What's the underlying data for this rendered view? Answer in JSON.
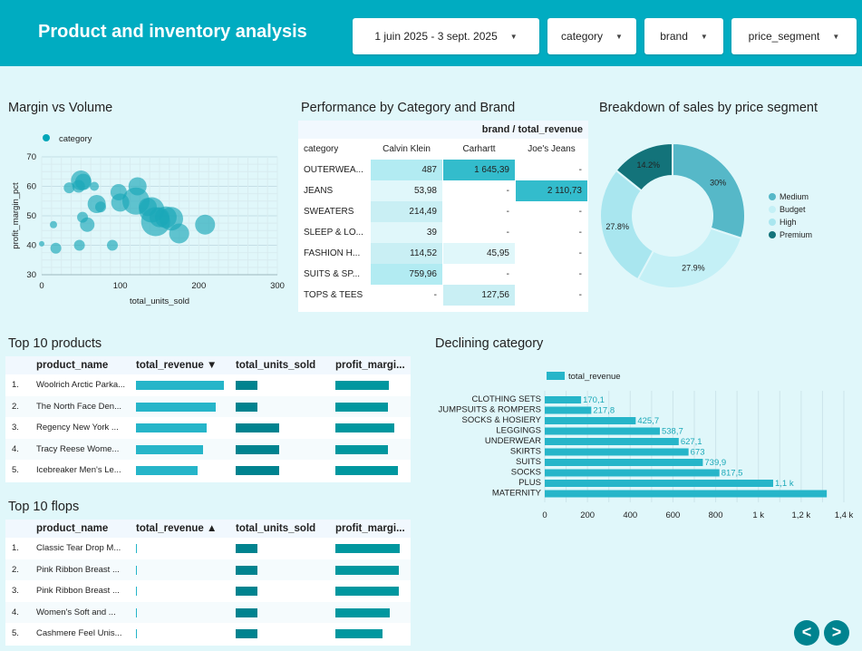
{
  "header": {
    "title": "Product and inventory analysis",
    "filters": {
      "date": "1 juin 2025 - 3 sept. 2025",
      "category": "category",
      "brand": "brand",
      "price_segment": "price_segment"
    }
  },
  "colors": {
    "header": "#00acc1",
    "background": "#e0f7fa",
    "bar": "#26b5c9",
    "dark": "#00838f",
    "pivot_high": "#4fc3d1",
    "pivot_mid": "#b2ebf2",
    "pivot_low": "#e0f7fa"
  },
  "scatter": {
    "title": "Margin vs Volume",
    "legend": "category",
    "xlabel": "total_units_sold",
    "ylabel": "profit_margin_pct",
    "xticks": [
      "0",
      "100",
      "200",
      "300"
    ],
    "yticks": [
      "30",
      "40",
      "50",
      "60",
      "70"
    ]
  },
  "pivot": {
    "title": "Performance by Category and Brand",
    "header": "brand / total_revenue",
    "row_header": "category",
    "columns": [
      "Calvin Klein",
      "Carhartt",
      "Joe's Jeans"
    ],
    "rows": [
      {
        "label": "OUTERWEA...",
        "values": [
          "487",
          "1 645,39",
          "-"
        ]
      },
      {
        "label": "JEANS",
        "values": [
          "53,98",
          "-",
          "2 110,73"
        ]
      },
      {
        "label": "SWEATERS",
        "values": [
          "214,49",
          "-",
          "-"
        ]
      },
      {
        "label": "SLEEP & LO...",
        "values": [
          "39",
          "-",
          "-"
        ]
      },
      {
        "label": "FASHION H...",
        "values": [
          "114,52",
          "45,95",
          "-"
        ]
      },
      {
        "label": "SUITS & SP...",
        "values": [
          "759,96",
          "-",
          "-"
        ]
      },
      {
        "label": "TOPS & TEES",
        "values": [
          "-",
          "127,56",
          "-"
        ]
      }
    ]
  },
  "donut": {
    "title": "Breakdown of sales by price segment",
    "legend": [
      "Medium",
      "Budget",
      "High",
      "Premium"
    ]
  },
  "top_products": {
    "title": "Top 10 products",
    "columns": [
      "product_name",
      "total_revenue",
      "total_units_sold",
      "profit_margi..."
    ],
    "sort_indicator": "▼",
    "rows": [
      {
        "num": "1.",
        "name": "Woolrich Arctic Parka...",
        "revenue": 1.0,
        "units": 0.25,
        "margin": 0.83
      },
      {
        "num": "2.",
        "name": "The North Face Den...",
        "revenue": 0.91,
        "units": 0.25,
        "margin": 0.82
      },
      {
        "num": "3.",
        "name": "Regency New York ...",
        "revenue": 0.8,
        "units": 0.5,
        "margin": 0.92
      },
      {
        "num": "4.",
        "name": "Tracy Reese Wome...",
        "revenue": 0.76,
        "units": 0.5,
        "margin": 0.81
      },
      {
        "num": "5.",
        "name": "Icebreaker Men's Le...",
        "revenue": 0.7,
        "units": 0.5,
        "margin": 0.97
      }
    ]
  },
  "top_flops": {
    "title": "Top 10 flops",
    "columns": [
      "product_name",
      "total_revenue",
      "total_units_sold",
      "profit_margi..."
    ],
    "sort_indicator": "▲",
    "rows": [
      {
        "num": "1.",
        "name": "Classic Tear Drop M...",
        "revenue": 0.01,
        "units": 0.25,
        "margin": 1.0
      },
      {
        "num": "2.",
        "name": "Pink Ribbon Breast ...",
        "revenue": 0.01,
        "units": 0.25,
        "margin": 0.98
      },
      {
        "num": "3.",
        "name": "Pink Ribbon Breast ...",
        "revenue": 0.01,
        "units": 0.25,
        "margin": 0.98
      },
      {
        "num": "4.",
        "name": "Women's Soft and ...",
        "revenue": 0.01,
        "units": 0.25,
        "margin": 0.84
      },
      {
        "num": "5.",
        "name": "Cashmere Feel Unis...",
        "revenue": 0.01,
        "units": 0.25,
        "margin": 0.73
      }
    ]
  },
  "bar_chart": {
    "title": "Declining category",
    "legend": "total_revenue",
    "xticks": [
      "0",
      "200",
      "400",
      "600",
      "800",
      "1 k",
      "1,2 k",
      "1,4 k"
    ]
  },
  "chart_data": [
    {
      "type": "scatter",
      "xlabel": "total_units_sold",
      "ylabel": "profit_margin_pct",
      "xlim": [
        0,
        300
      ],
      "ylim": [
        30,
        70
      ],
      "legend": [
        "category"
      ],
      "points": [
        {
          "x": 0,
          "y": 40.5,
          "s": 3
        },
        {
          "x": 15,
          "y": 47,
          "s": 4
        },
        {
          "x": 18,
          "y": 39,
          "s": 6
        },
        {
          "x": 35,
          "y": 59.5,
          "s": 6
        },
        {
          "x": 47,
          "y": 60,
          "s": 7
        },
        {
          "x": 50,
          "y": 62,
          "s": 11
        },
        {
          "x": 53,
          "y": 61.5,
          "s": 9
        },
        {
          "x": 48,
          "y": 40,
          "s": 6
        },
        {
          "x": 52,
          "y": 49.5,
          "s": 6
        },
        {
          "x": 58,
          "y": 47,
          "s": 8
        },
        {
          "x": 67,
          "y": 60,
          "s": 5
        },
        {
          "x": 70,
          "y": 54,
          "s": 10
        },
        {
          "x": 75,
          "y": 53,
          "s": 6
        },
        {
          "x": 90,
          "y": 40,
          "s": 6
        },
        {
          "x": 98,
          "y": 58,
          "s": 9
        },
        {
          "x": 100,
          "y": 54.5,
          "s": 10
        },
        {
          "x": 120,
          "y": 55,
          "s": 15
        },
        {
          "x": 122,
          "y": 60,
          "s": 10
        },
        {
          "x": 135,
          "y": 53,
          "s": 10
        },
        {
          "x": 140,
          "y": 52,
          "s": 14
        },
        {
          "x": 145,
          "y": 48,
          "s": 16
        },
        {
          "x": 150,
          "y": 49.5,
          "s": 11
        },
        {
          "x": 158,
          "y": 49.5,
          "s": 12
        },
        {
          "x": 165,
          "y": 49,
          "s": 13
        },
        {
          "x": 175,
          "y": 44,
          "s": 11
        },
        {
          "x": 208,
          "y": 47,
          "s": 11
        }
      ]
    },
    {
      "type": "pie",
      "labels": [
        "Medium",
        "Budget",
        "High",
        "Premium"
      ],
      "values": [
        30,
        27.9,
        27.8,
        14.2
      ],
      "value_labels": [
        "30%",
        "27.9%",
        "27.8%",
        "14.2%"
      ],
      "colors": [
        "#56b8c8",
        "#c4f0f6",
        "#a9e6ef",
        "#13737a"
      ]
    },
    {
      "type": "bar",
      "orientation": "horizontal",
      "categories": [
        "CLOTHING SETS",
        "JUMPSUITS & ROMPERS",
        "SOCKS & HOSIERY",
        "LEGGINGS",
        "UNDERWEAR",
        "SKIRTS",
        "SUITS",
        "SOCKS",
        "PLUS",
        "MATERNITY"
      ],
      "values": [
        170.1,
        217.8,
        425.7,
        538.7,
        627.1,
        673,
        739.9,
        817.5,
        1069,
        1320
      ],
      "value_labels": [
        "170,1",
        "217,8",
        "425,7",
        "538,7",
        "627,1",
        "673",
        "739,9",
        "817,5",
        "1,1 k",
        ""
      ],
      "xlim": [
        0,
        1400
      ],
      "series": [
        {
          "name": "total_revenue"
        }
      ]
    }
  ]
}
